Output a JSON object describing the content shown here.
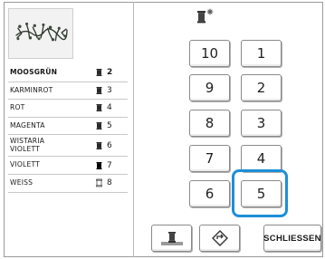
{
  "thread_list": [
    {
      "name": "MOOSGRÜN",
      "number": "2",
      "selected": true,
      "spool": "dark"
    },
    {
      "name": "KARMINROT",
      "number": "3",
      "selected": false,
      "spool": "dark"
    },
    {
      "name": "ROT",
      "number": "4",
      "selected": false,
      "spool": "dark"
    },
    {
      "name": "MAGENTA",
      "number": "5",
      "selected": false,
      "spool": "dark"
    },
    {
      "name": "WISTARIA\nVIOLETT",
      "number": "6",
      "selected": false,
      "spool": "dark"
    },
    {
      "name": "VIOLETT",
      "number": "7",
      "selected": false,
      "spool": "dark"
    },
    {
      "name": "WEISS",
      "number": "8",
      "selected": false,
      "spool": "light"
    }
  ],
  "keypad": {
    "keys": [
      "10",
      "1",
      "9",
      "2",
      "8",
      "3",
      "7",
      "4",
      "6",
      "5"
    ],
    "highlighted": "5"
  },
  "buttons": {
    "close_label": "SCHLIESSEN"
  },
  "icons": {
    "top": "spool-sparkle-icon",
    "spool_button": "spool-needle-icon",
    "rotate_button": "rotate-diamond-icon"
  },
  "colors": {
    "highlight": "#1e8fd6",
    "spool_dark": "#2a2a2a",
    "spool_light": "#ffffff"
  }
}
